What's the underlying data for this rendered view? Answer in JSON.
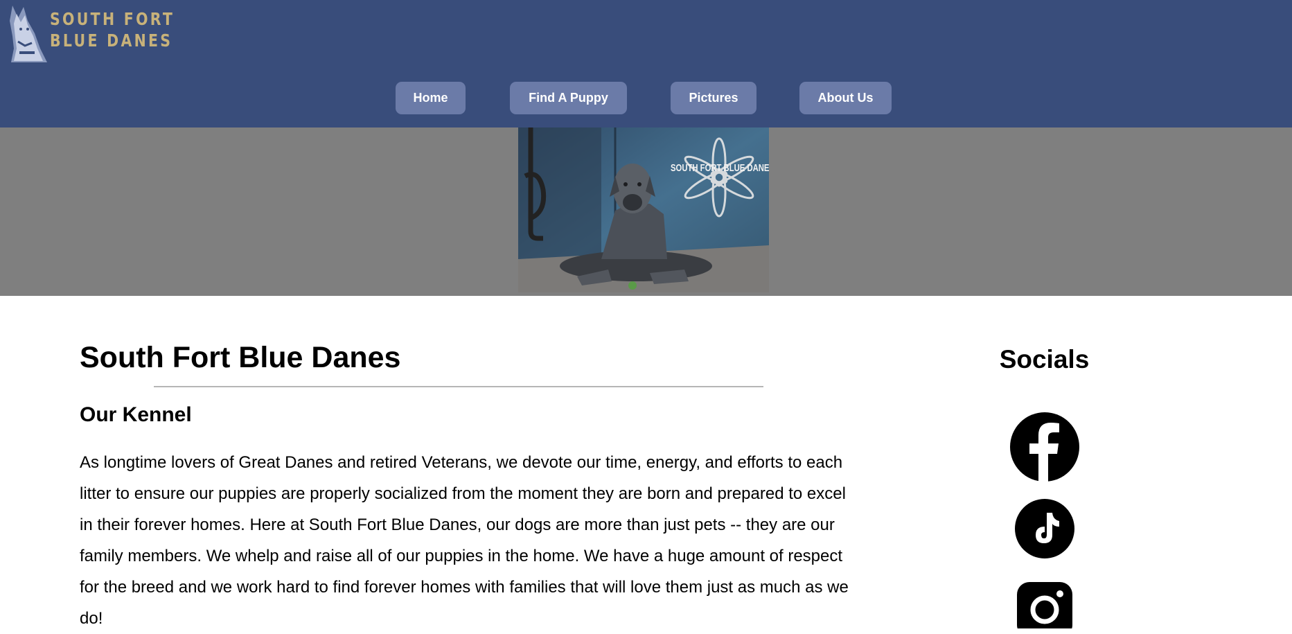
{
  "brand": {
    "line1": "SOUTH FORT",
    "line2": "BLUE DANES",
    "color": "#c8b27a"
  },
  "colors": {
    "header_bg": "#394d7b",
    "nav_button_bg": "#6b7ba8",
    "banner_bg": "#7f7f7f"
  },
  "nav": {
    "home": "Home",
    "find_puppy": "Find A Puppy",
    "pictures": "Pictures",
    "about": "About Us"
  },
  "hero": {
    "watermark": "SOUTH FORT BLUE DANES"
  },
  "main": {
    "title": "South Fort Blue Danes",
    "subtitle": "Our Kennel",
    "paragraph": "As longtime lovers of Great Danes and retired Veterans, we devote our time, energy, and efforts to each litter to ensure our puppies are properly socialized from the moment they are born and prepared to excel in their forever homes. Here at South Fort Blue Danes, our dogs are more than just pets -- they are our family members. We whelp and raise all of our puppies in the home. We have a huge amount of respect for the breed and we work hard to find forever homes with families that will love them just as much as we do!"
  },
  "socials": {
    "title": "Socials",
    "icons": [
      "facebook-icon",
      "tiktok-icon",
      "instagram-icon"
    ]
  }
}
